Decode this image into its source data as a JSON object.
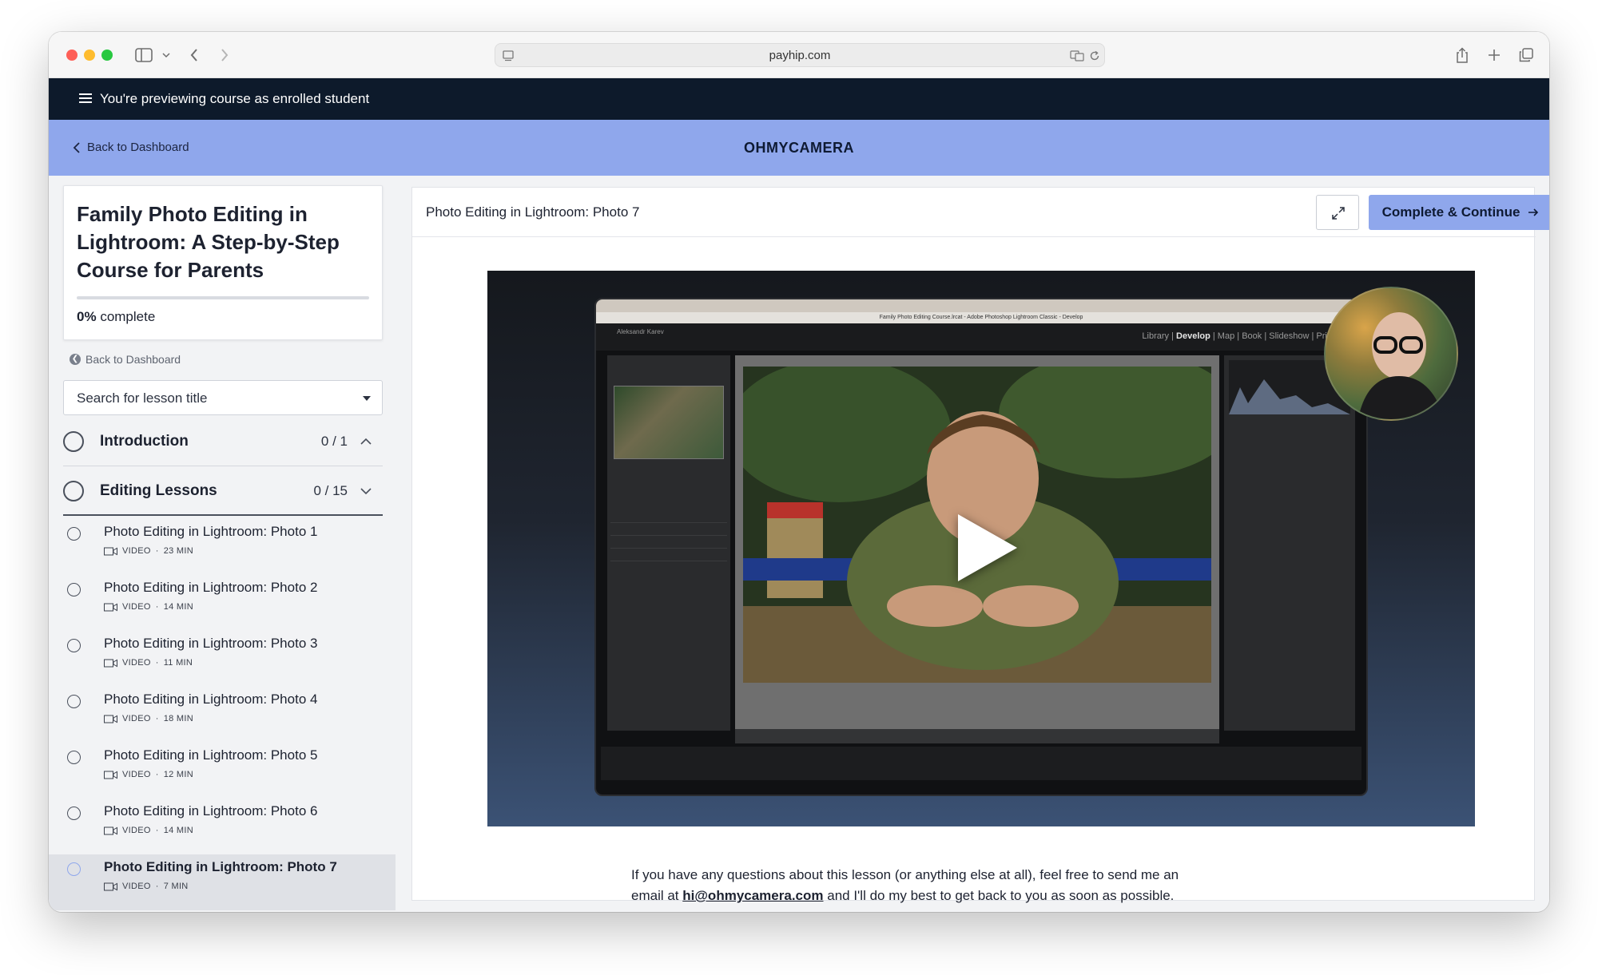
{
  "browser": {
    "url": "payhip.com"
  },
  "preview_banner": {
    "text": "You're previewing course as enrolled student"
  },
  "header": {
    "back_label": "Back to Dashboard",
    "brand": "OHMYCAMERA"
  },
  "sidebar": {
    "course_title": "Family Photo Editing in Lightroom: A Step-by-Step Course for Parents",
    "progress_percent": 0,
    "progress_value": "0%",
    "progress_suffix": "complete",
    "back_label": "Back to Dashboard",
    "search_placeholder": "Search for lesson title",
    "sections": [
      {
        "name": "Introduction",
        "count": "0 / 1",
        "expanded": false
      },
      {
        "name": "Editing Lessons",
        "count": "0 / 15",
        "expanded": true
      }
    ],
    "lessons": [
      {
        "title": "Photo Editing in Lightroom: Photo 1",
        "type": "VIDEO",
        "duration": "23 MIN"
      },
      {
        "title": "Photo Editing in Lightroom: Photo 2",
        "type": "VIDEO",
        "duration": "14 MIN"
      },
      {
        "title": "Photo Editing in Lightroom: Photo 3",
        "type": "VIDEO",
        "duration": "11 MIN"
      },
      {
        "title": "Photo Editing in Lightroom: Photo 4",
        "type": "VIDEO",
        "duration": "18 MIN"
      },
      {
        "title": "Photo Editing in Lightroom: Photo 5",
        "type": "VIDEO",
        "duration": "12 MIN"
      },
      {
        "title": "Photo Editing in Lightroom: Photo 6",
        "type": "VIDEO",
        "duration": "14 MIN"
      },
      {
        "title": "Photo Editing in Lightroom: Photo 7",
        "type": "VIDEO",
        "duration": "7 MIN",
        "current": true
      }
    ]
  },
  "main": {
    "lesson_title": "Photo Editing in Lightroom: Photo 7",
    "complete_button": "Complete & Continue",
    "video": {
      "lightroom_modules": [
        "Library",
        "Develop",
        "Map",
        "Book",
        "Slideshow",
        "Print"
      ],
      "active_module": "Develop",
      "lightroom_user": "Aleksandr Karev",
      "window_title": "Family Photo Editing Course.lrcat - Adobe Photoshop Lightroom Classic - Develop"
    },
    "body_text_1": "If you have any questions about this lesson (or anything else at all), feel free to send me an",
    "body_text_2_prefix": "email at ",
    "body_email": "hi@ohmycamera.com",
    "body_text_2_suffix": " and I'll do my best to get back to you as soon as possible."
  },
  "colors": {
    "accent": "#8fa7ec",
    "banner": "#0d1a2b",
    "sidebar_bg": "#f2f3f5"
  }
}
